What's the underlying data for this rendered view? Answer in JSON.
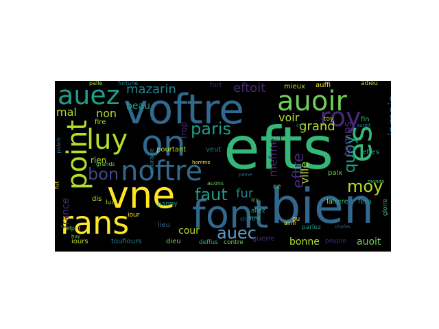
{
  "palette": {
    "yellow": "#fde725",
    "lime": "#b5de2b",
    "green": "#6ece58",
    "teal": "#35b779",
    "cyan": "#1f9e89",
    "steel": "#26828e",
    "blue": "#31688e",
    "indigo": "#3e4989",
    "purple": "#482878",
    "dark": "#440154",
    "lightblue": "#5e9dc8"
  },
  "words": {
    "efts": "efts",
    "bien": "bien",
    "voftre": "voftre",
    "font": "font",
    "rans": "rans",
    "vne": "vne",
    "nostre": "noftre",
    "auoir": "auoir",
    "on": "on",
    "es": "es",
    "auez": "auez",
    "point": "point",
    "luy": "luy",
    "roy": "roy",
    "moy": "moy",
    "paris": "paris",
    "bon": "bon",
    "faut": "faut",
    "auec": "auec",
    "eftre": "eftre",
    "eftoit": "eftoit",
    "mazarin": "mazarin",
    "quoy": "quoy",
    "grand": "grand",
    "voir": "voir",
    "fur": "fur",
    "mesme": "mefme",
    "iamais": "iamais",
    "ville": "ville",
    "temps": "temps",
    "non": "non",
    "mal": "mal",
    "beau": "beau",
    "rien": "rien",
    "france": "france",
    "cour": "cour",
    "bonne": "bonne",
    "auoit": "auoit",
    "toufiours": "toufiours",
    "iours": "iours",
    "dieu": "dieu",
    "deffus": "deffus",
    "contre": "contre",
    "guerre": "guerre",
    "peuple": "peuple",
    "fin": "fin",
    "eftes": "eftes",
    "paix": "paix",
    "frere": "frere",
    "fera": "fera",
    "gloire": "gloire",
    "lieu": "lieu",
    "iour": "iour",
    "parmy": "parmy",
    "auons": "auons",
    "veut": "veut",
    "pourtant": "pourtant",
    "courage": "courage",
    "trop": "trop",
    "fort": "fort",
    "mieux": "mieux",
    "auffi": "auffi",
    "adieu": "adieu",
    "fortune": "fortune",
    "palle": "palle",
    "fire": "fire",
    "dis": "dis",
    "luis": "luis",
    "ainfi": "ainfi",
    "vray": "vray",
    "icy": "icy",
    "allez": "allez",
    "parlez": "parlez",
    "ou": "ou",
    "toy": "toy",
    "monde": "monde",
    "grands": "grands",
    "chofe": "chofe",
    "chofes": "chofes",
    "huy": "huy",
    "homme": "homme",
    "ce": "ce",
    "auroit": "auroit",
    "peine": "peine",
    "fut": "fut",
    "palais": "palais",
    "efprit": "efprit",
    "cy": "cy",
    "la": "la"
  }
}
